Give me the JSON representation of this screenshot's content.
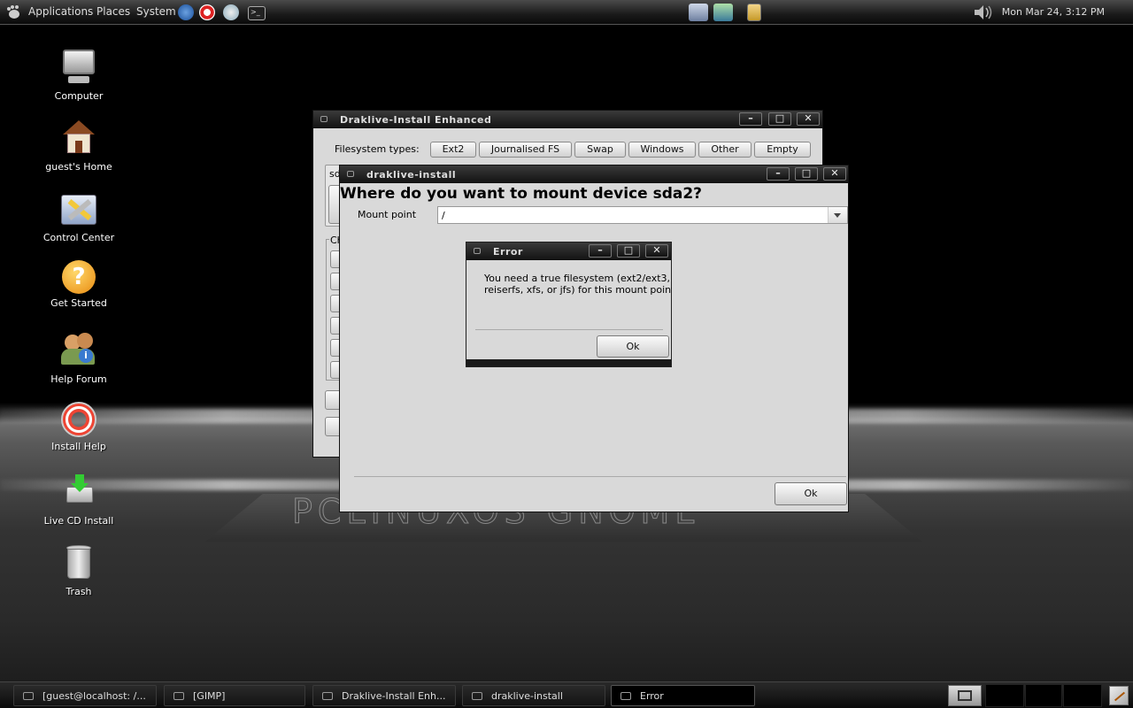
{
  "top_panel": {
    "menus": [
      "Applications",
      "Places",
      "System"
    ],
    "clock": "Mon Mar 24,  3:12 PM",
    "launchers": [
      "firefox-icon",
      "lifebuoy-icon",
      "globe-icon",
      "terminal-icon"
    ]
  },
  "desktop_icons": [
    {
      "label": "Computer",
      "icon": "computer-icon"
    },
    {
      "label": "guest's Home",
      "icon": "home-icon"
    },
    {
      "label": "Control Center",
      "icon": "control-center-icon"
    },
    {
      "label": "Get Started",
      "icon": "help-icon"
    },
    {
      "label": "Help Forum",
      "icon": "help-forum-icon"
    },
    {
      "label": "Install Help",
      "icon": "lifebuoy-icon"
    },
    {
      "label": "Live CD Install",
      "icon": "install-icon"
    },
    {
      "label": "Trash",
      "icon": "trash-icon"
    }
  ],
  "window_back": {
    "title": "Draklive-Install Enhanced",
    "fs_label": "Filesystem types:",
    "fs_buttons": [
      "Ext2",
      "Journalised FS",
      "Swap",
      "Windows",
      "Other",
      "Empty"
    ],
    "tab_fragment": "sd",
    "group_fragment": "Ch"
  },
  "window_mount": {
    "title": "draklive-install",
    "heading": "Where do you want to mount device sda2?",
    "mount_label": "Mount point",
    "mount_value": "/",
    "ok_label": "Ok"
  },
  "window_error": {
    "title": "Error",
    "message_line1": "You need a true filesystem (ext2/ext3,",
    "message_line2": "reiserfs, xfs, or jfs) for this mount point",
    "ok_label": "Ok"
  },
  "window_controls": {
    "minimize": "–",
    "maximize": "□",
    "close": "✕"
  },
  "taskbar": {
    "tasks": [
      "[guest@localhost: /...",
      "[GIMP]",
      "Draklive-Install Enh...",
      "draklive-install",
      "Error"
    ]
  }
}
